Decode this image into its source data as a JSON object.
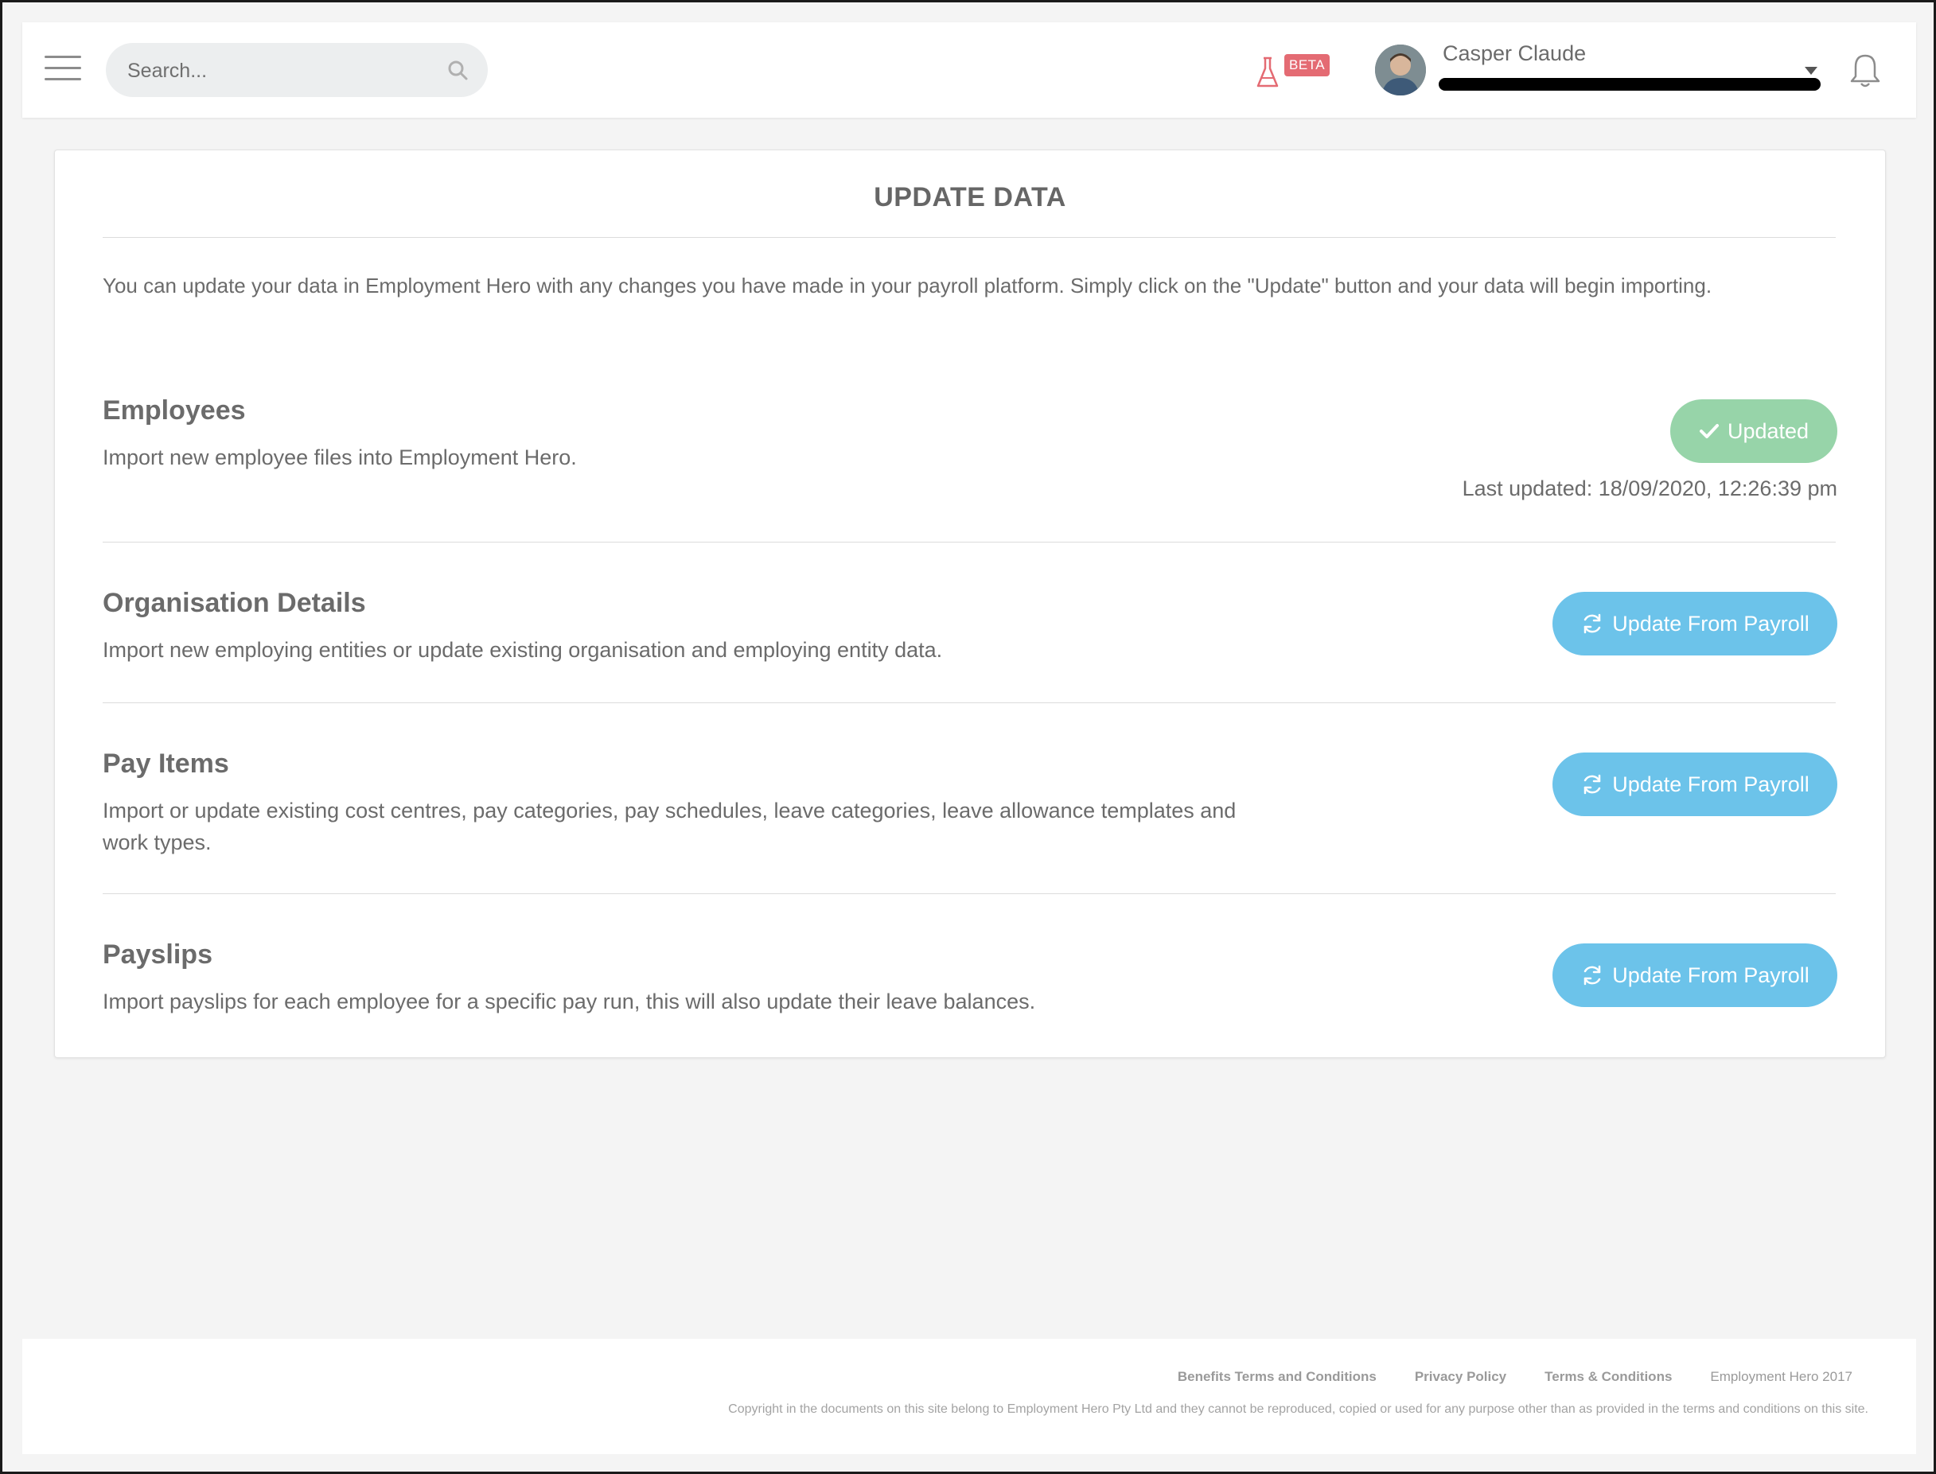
{
  "header": {
    "search_placeholder": "Search...",
    "beta_label": "BETA",
    "user_name": "Casper Claude"
  },
  "main": {
    "title": "UPDATE DATA",
    "intro": "You can update your data in Employment Hero with any changes you have made in your payroll platform. Simply click on the \"Update\" button and your data will begin importing.",
    "sections": [
      {
        "title": "Employees",
        "description": "Import new employee files into Employment Hero.",
        "button_label": "Updated",
        "last_updated": "Last updated: 18/09/2020, 12:26:39 pm"
      },
      {
        "title": "Organisation Details",
        "description": "Import new employing entities or update existing organisation and employing entity data.",
        "button_label": "Update From Payroll"
      },
      {
        "title": "Pay Items",
        "description": "Import or update existing cost centres, pay categories, pay schedules, leave categories, leave allowance templates and work types.",
        "button_label": "Update From Payroll"
      },
      {
        "title": "Payslips",
        "description": "Import payslips for each employee for a specific pay run, this will also update their leave balances.",
        "button_label": "Update From Payroll"
      }
    ]
  },
  "footer": {
    "links": [
      "Benefits Terms and Conditions",
      "Privacy Policy",
      "Terms & Conditions"
    ],
    "copy_year": "Employment Hero 2017",
    "copyright": "Copyright in the documents on this site belong to Employment Hero Pty Ltd and they cannot be reproduced, copied or used for any purpose other than as provided in the terms and conditions on this site."
  },
  "colors": {
    "updated_button": "#97d4a9",
    "payroll_button": "#6cc3ea",
    "beta_badge": "#e46b73"
  },
  "icons": [
    "hamburger-icon",
    "search-icon",
    "flask-icon",
    "avatar",
    "chevron-down-icon",
    "bell-icon",
    "check-icon",
    "refresh-icon"
  ]
}
